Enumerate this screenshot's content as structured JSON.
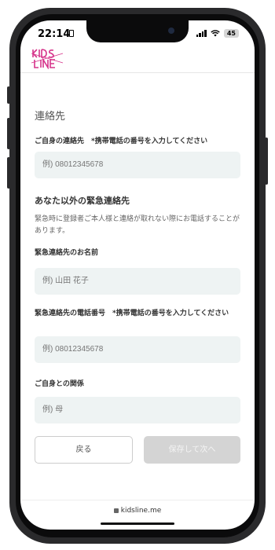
{
  "status_bar": {
    "time": "22:14",
    "battery": "45"
  },
  "brand": {
    "logo_line1": "KIDS",
    "logo_line2": "LINE",
    "color": "#d6338a"
  },
  "form": {
    "section_title": "連絡先",
    "own_contact_label": "ご自身の連絡先　*携帯電話の番号を入力してください",
    "own_contact_placeholder": "例) 08012345678",
    "emergency_heading": "あなた以外の緊急連絡先",
    "emergency_note": "緊急時に登録者ご本人様と連絡が取れない際にお電話することがあります。",
    "emergency_name_label": "緊急連絡先のお名前",
    "emergency_name_placeholder": "例) 山田 花子",
    "emergency_phone_label": "緊急連絡先の電話番号　*携帯電話の番号を入力してください",
    "emergency_phone_placeholder": "例) 08012345678",
    "relation_label": "ご自身との関係",
    "relation_placeholder": "例) 母"
  },
  "buttons": {
    "back": "戻る",
    "save_next": "保存して次へ"
  },
  "footer": {
    "url": "kidsline.me"
  }
}
